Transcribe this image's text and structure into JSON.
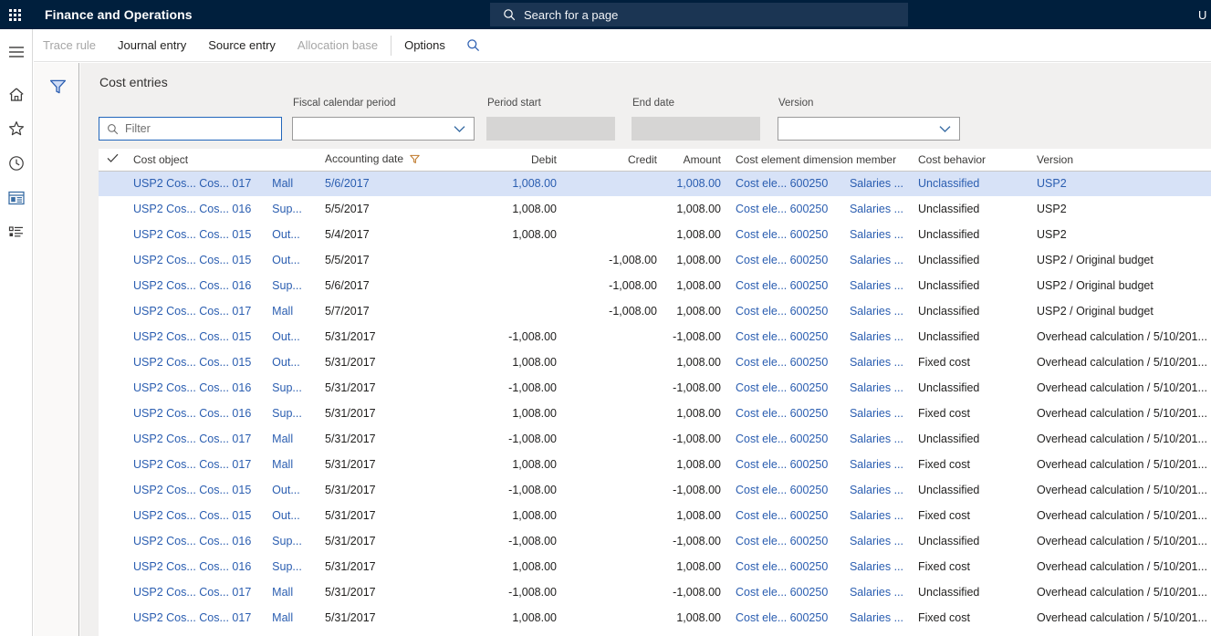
{
  "topbar": {
    "waffle_icon": "app-launcher-icon",
    "app_title": "Finance and Operations",
    "search_placeholder": "Search for a page",
    "search_icon": "search-icon",
    "edge_char": "U"
  },
  "rail": {
    "items": [
      {
        "name": "hamburger-menu",
        "icon": "hamburger-icon"
      },
      {
        "name": "home",
        "icon": "home-icon"
      },
      {
        "name": "favorites",
        "icon": "star-icon"
      },
      {
        "name": "recent",
        "icon": "clock-icon"
      },
      {
        "name": "workspaces",
        "icon": "dashboard-tile-icon"
      },
      {
        "name": "modules",
        "icon": "list-icon"
      }
    ]
  },
  "commandbar": {
    "tabs": [
      {
        "label": "Trace rule",
        "enabled": false
      },
      {
        "label": "Journal entry",
        "enabled": true
      },
      {
        "label": "Source entry",
        "enabled": true
      },
      {
        "label": "Allocation base",
        "enabled": false
      },
      {
        "label": "Options",
        "enabled": true
      }
    ],
    "search_icon": "search-icon"
  },
  "filter_rail": {
    "funnel_icon": "filter-funnel-icon"
  },
  "page": {
    "title": "Cost entries"
  },
  "form": {
    "filter": {
      "label": "",
      "placeholder": "Filter",
      "value": "",
      "icon": "search-icon"
    },
    "fiscal_calendar_period": {
      "label": "Fiscal calendar period",
      "value": ""
    },
    "period_start": {
      "label": "Period start",
      "value": ""
    },
    "end_date": {
      "label": "End date",
      "value": ""
    },
    "version": {
      "label": "Version",
      "value": ""
    }
  },
  "grid": {
    "columns": [
      "Cost object",
      "Accounting date",
      "Debit",
      "Credit",
      "Amount",
      "Cost element dimension member",
      "Cost behavior",
      "Version"
    ],
    "accounting_date_has_filter": true,
    "selected_row_index": 0,
    "rows": [
      {
        "co1": "USP2",
        "co2": "Cos...",
        "co3": "Cos...",
        "co4": "017",
        "co5": "Mall",
        "date": "5/6/2017",
        "debit": "1,008.00",
        "credit": "",
        "amount": "1,008.00",
        "ce1": "Cost ele...",
        "ce2": "600250",
        "ce3": "Salaries ...",
        "behavior": "Unclassified",
        "version": "USP2"
      },
      {
        "co1": "USP2",
        "co2": "Cos...",
        "co3": "Cos...",
        "co4": "016",
        "co5": "Sup...",
        "date": "5/5/2017",
        "debit": "1,008.00",
        "credit": "",
        "amount": "1,008.00",
        "ce1": "Cost ele...",
        "ce2": "600250",
        "ce3": "Salaries ...",
        "behavior": "Unclassified",
        "version": "USP2"
      },
      {
        "co1": "USP2",
        "co2": "Cos...",
        "co3": "Cos...",
        "co4": "015",
        "co5": "Out...",
        "date": "5/4/2017",
        "debit": "1,008.00",
        "credit": "",
        "amount": "1,008.00",
        "ce1": "Cost ele...",
        "ce2": "600250",
        "ce3": "Salaries ...",
        "behavior": "Unclassified",
        "version": "USP2"
      },
      {
        "co1": "USP2",
        "co2": "Cos...",
        "co3": "Cos...",
        "co4": "015",
        "co5": "Out...",
        "date": "5/5/2017",
        "debit": "",
        "credit": "-1,008.00",
        "amount": "1,008.00",
        "ce1": "Cost ele...",
        "ce2": "600250",
        "ce3": "Salaries ...",
        "behavior": "Unclassified",
        "version": "USP2 / Original budget"
      },
      {
        "co1": "USP2",
        "co2": "Cos...",
        "co3": "Cos...",
        "co4": "016",
        "co5": "Sup...",
        "date": "5/6/2017",
        "debit": "",
        "credit": "-1,008.00",
        "amount": "1,008.00",
        "ce1": "Cost ele...",
        "ce2": "600250",
        "ce3": "Salaries ...",
        "behavior": "Unclassified",
        "version": "USP2 / Original budget"
      },
      {
        "co1": "USP2",
        "co2": "Cos...",
        "co3": "Cos...",
        "co4": "017",
        "co5": "Mall",
        "date": "5/7/2017",
        "debit": "",
        "credit": "-1,008.00",
        "amount": "1,008.00",
        "ce1": "Cost ele...",
        "ce2": "600250",
        "ce3": "Salaries ...",
        "behavior": "Unclassified",
        "version": "USP2 / Original budget"
      },
      {
        "co1": "USP2",
        "co2": "Cos...",
        "co3": "Cos...",
        "co4": "015",
        "co5": "Out...",
        "date": "5/31/2017",
        "debit": "-1,008.00",
        "credit": "",
        "amount": "-1,008.00",
        "ce1": "Cost ele...",
        "ce2": "600250",
        "ce3": "Salaries ...",
        "behavior": "Unclassified",
        "version": "Overhead calculation / 5/10/201..."
      },
      {
        "co1": "USP2",
        "co2": "Cos...",
        "co3": "Cos...",
        "co4": "015",
        "co5": "Out...",
        "date": "5/31/2017",
        "debit": "1,008.00",
        "credit": "",
        "amount": "1,008.00",
        "ce1": "Cost ele...",
        "ce2": "600250",
        "ce3": "Salaries ...",
        "behavior": "Fixed cost",
        "version": "Overhead calculation / 5/10/201..."
      },
      {
        "co1": "USP2",
        "co2": "Cos...",
        "co3": "Cos...",
        "co4": "016",
        "co5": "Sup...",
        "date": "5/31/2017",
        "debit": "-1,008.00",
        "credit": "",
        "amount": "-1,008.00",
        "ce1": "Cost ele...",
        "ce2": "600250",
        "ce3": "Salaries ...",
        "behavior": "Unclassified",
        "version": "Overhead calculation / 5/10/201..."
      },
      {
        "co1": "USP2",
        "co2": "Cos...",
        "co3": "Cos...",
        "co4": "016",
        "co5": "Sup...",
        "date": "5/31/2017",
        "debit": "1,008.00",
        "credit": "",
        "amount": "1,008.00",
        "ce1": "Cost ele...",
        "ce2": "600250",
        "ce3": "Salaries ...",
        "behavior": "Fixed cost",
        "version": "Overhead calculation / 5/10/201..."
      },
      {
        "co1": "USP2",
        "co2": "Cos...",
        "co3": "Cos...",
        "co4": "017",
        "co5": "Mall",
        "date": "5/31/2017",
        "debit": "-1,008.00",
        "credit": "",
        "amount": "-1,008.00",
        "ce1": "Cost ele...",
        "ce2": "600250",
        "ce3": "Salaries ...",
        "behavior": "Unclassified",
        "version": "Overhead calculation / 5/10/201..."
      },
      {
        "co1": "USP2",
        "co2": "Cos...",
        "co3": "Cos...",
        "co4": "017",
        "co5": "Mall",
        "date": "5/31/2017",
        "debit": "1,008.00",
        "credit": "",
        "amount": "1,008.00",
        "ce1": "Cost ele...",
        "ce2": "600250",
        "ce3": "Salaries ...",
        "behavior": "Fixed cost",
        "version": "Overhead calculation / 5/10/201..."
      },
      {
        "co1": "USP2",
        "co2": "Cos...",
        "co3": "Cos...",
        "co4": "015",
        "co5": "Out...",
        "date": "5/31/2017",
        "debit": "-1,008.00",
        "credit": "",
        "amount": "-1,008.00",
        "ce1": "Cost ele...",
        "ce2": "600250",
        "ce3": "Salaries ...",
        "behavior": "Unclassified",
        "version": "Overhead calculation / 5/10/201..."
      },
      {
        "co1": "USP2",
        "co2": "Cos...",
        "co3": "Cos...",
        "co4": "015",
        "co5": "Out...",
        "date": "5/31/2017",
        "debit": "1,008.00",
        "credit": "",
        "amount": "1,008.00",
        "ce1": "Cost ele...",
        "ce2": "600250",
        "ce3": "Salaries ...",
        "behavior": "Fixed cost",
        "version": "Overhead calculation / 5/10/201..."
      },
      {
        "co1": "USP2",
        "co2": "Cos...",
        "co3": "Cos...",
        "co4": "016",
        "co5": "Sup...",
        "date": "5/31/2017",
        "debit": "-1,008.00",
        "credit": "",
        "amount": "-1,008.00",
        "ce1": "Cost ele...",
        "ce2": "600250",
        "ce3": "Salaries ...",
        "behavior": "Unclassified",
        "version": "Overhead calculation / 5/10/201..."
      },
      {
        "co1": "USP2",
        "co2": "Cos...",
        "co3": "Cos...",
        "co4": "016",
        "co5": "Sup...",
        "date": "5/31/2017",
        "debit": "1,008.00",
        "credit": "",
        "amount": "1,008.00",
        "ce1": "Cost ele...",
        "ce2": "600250",
        "ce3": "Salaries ...",
        "behavior": "Fixed cost",
        "version": "Overhead calculation / 5/10/201..."
      },
      {
        "co1": "USP2",
        "co2": "Cos...",
        "co3": "Cos...",
        "co4": "017",
        "co5": "Mall",
        "date": "5/31/2017",
        "debit": "-1,008.00",
        "credit": "",
        "amount": "-1,008.00",
        "ce1": "Cost ele...",
        "ce2": "600250",
        "ce3": "Salaries ...",
        "behavior": "Unclassified",
        "version": "Overhead calculation / 5/10/201..."
      },
      {
        "co1": "USP2",
        "co2": "Cos...",
        "co3": "Cos...",
        "co4": "017",
        "co5": "Mall",
        "date": "5/31/2017",
        "debit": "1,008.00",
        "credit": "",
        "amount": "1,008.00",
        "ce1": "Cost ele...",
        "ce2": "600250",
        "ce3": "Salaries ...",
        "behavior": "Fixed cost",
        "version": "Overhead calculation / 5/10/201..."
      }
    ]
  },
  "colors": {
    "topbar_bg": "#001f3d",
    "search_bg": "#1b3553",
    "link": "#2a5db0",
    "selected_row_bg": "#d7e2f7",
    "content_bg": "#f1f0ef",
    "focus_border": "#2266bb"
  }
}
